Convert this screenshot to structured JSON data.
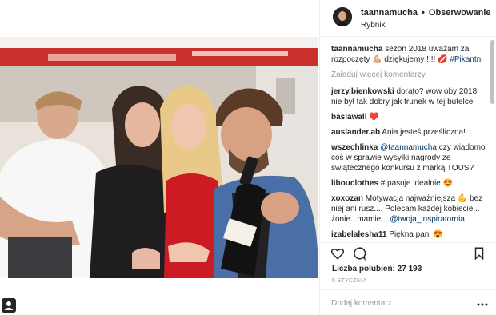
{
  "post": {
    "username": "taannamucha",
    "separator": "•",
    "follow_label": "Obserwowanie",
    "location": "Rybnik",
    "caption_user": "taannamucha",
    "caption_text": "sezon 2018 uważam za rozpoczęty 💪🏼 dziękujemy !!!! 💋",
    "caption_hashtag": "#Pikantni",
    "load_more_label": "Załaduj więcej komentarzy",
    "comments": [
      {
        "user": "jerzy.bienkowski",
        "text": "dorato? wow oby 2018 nie był tak dobry jak trunek w tej butelce"
      },
      {
        "user": "basiawall",
        "text": "❤️"
      },
      {
        "user": "auslander.ab",
        "text": "Ania jesteś prześliczna!"
      },
      {
        "user": "wszechlinka",
        "mention": "@taannamucha",
        "text": "czy wiadomo coś w sprawie wysyłki nagrody ze świątecznego konkursu z marką TOUS?"
      },
      {
        "user": "libouclothes",
        "text": "# pasuje idealnie 😍"
      },
      {
        "user": "xoxozan",
        "text": "Motywacja najważniejsza 💪 bez niej ani rusz.... Polecam każdej kobiecie .. żonie.. mamie ..",
        "mention": "@twoja_inspiratornia"
      },
      {
        "user": "izabelalesha11",
        "text": "Piękna pani 😍"
      }
    ],
    "likes_label": "Liczba polubień: 27 193",
    "date_label": "5 STYCZNIA",
    "add_comment_placeholder": "Dodaj komentarz..."
  },
  "icons": {
    "like": "heart-outline-icon",
    "comment": "speech-bubble-icon",
    "save": "bookmark-icon",
    "more": "more-dots-icon",
    "user": "user-silhouette-icon"
  }
}
